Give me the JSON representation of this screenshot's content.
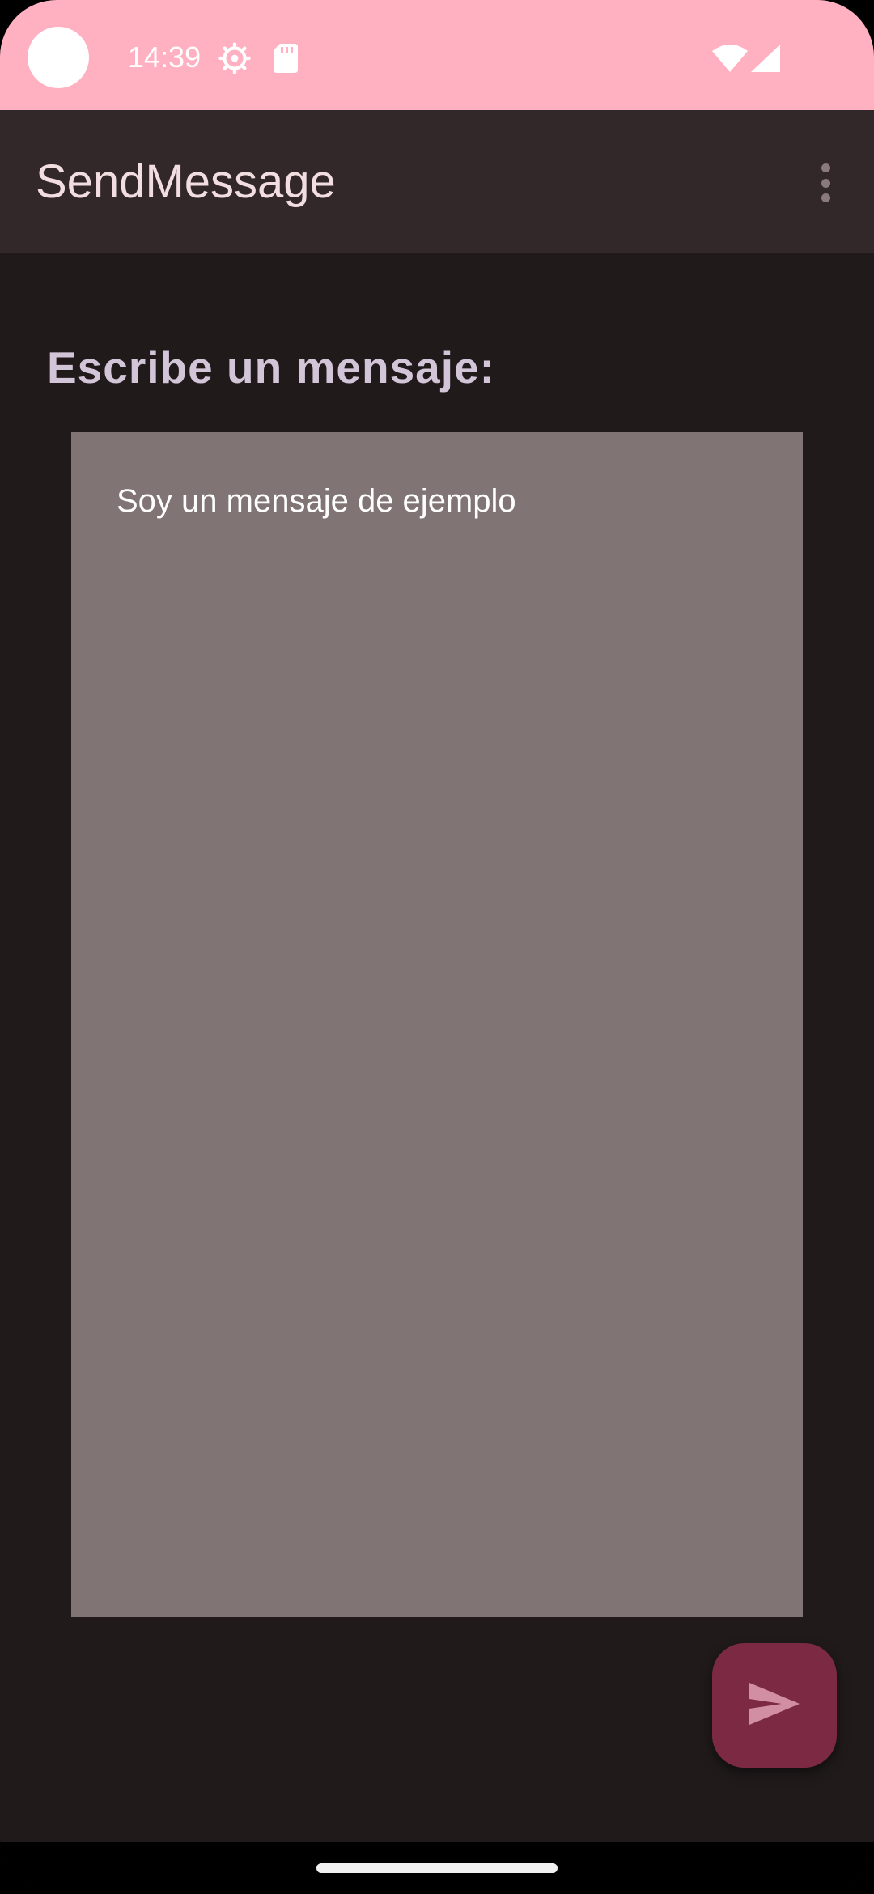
{
  "status_bar": {
    "time": "14:39",
    "icons": [
      "settings-icon",
      "sd-card-icon",
      "wifi-icon",
      "signal-icon"
    ],
    "background": "#ffb1c1"
  },
  "app_bar": {
    "title": "SendMessage",
    "menu_icon": "more-vert-icon",
    "background": "#322729"
  },
  "main": {
    "prompt_label": "Escribe un mensaje:",
    "message_value": "Soy un mensaje de ejemplo",
    "input_background": "#817475",
    "background": "#201a1b"
  },
  "fab": {
    "icon": "send-icon",
    "background": "#7c2a43"
  }
}
